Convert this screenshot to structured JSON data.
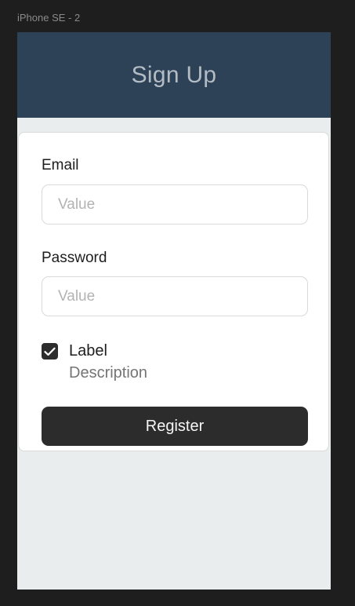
{
  "frame": {
    "label": "iPhone SE - 2"
  },
  "header": {
    "title": "Sign Up",
    "background": "#2e4257"
  },
  "form": {
    "email": {
      "label": "Email",
      "placeholder": "Value",
      "value": ""
    },
    "password": {
      "label": "Password",
      "placeholder": "Value",
      "value": ""
    },
    "checkbox": {
      "label": "Label",
      "description": "Description",
      "checked": true,
      "icon": "check-icon"
    },
    "register_label": "Register"
  },
  "colors": {
    "button": "#2c2c2c",
    "page_background": "#e9eded",
    "card": "#ffffff"
  }
}
